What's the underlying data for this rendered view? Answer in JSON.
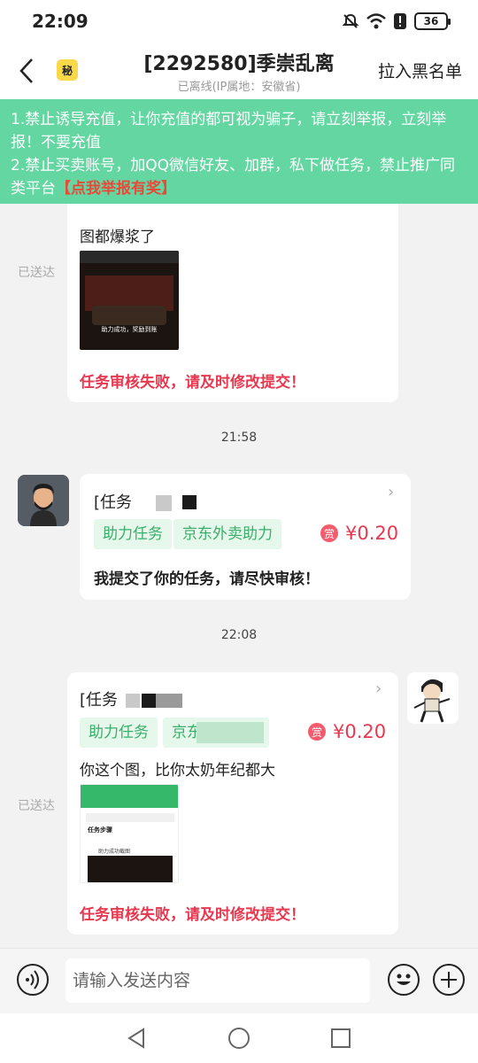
{
  "status_bar": {
    "time": "22:09",
    "battery": "36"
  },
  "header": {
    "secret_badge": "秘",
    "title": "[2292580]季崇乱离",
    "subtitle": "已离线(IP属地：安徽省)",
    "blacklist_label": "拉入黑名单"
  },
  "notice": {
    "line1": "1.禁止诱导充值，让你充值的都可视为骗子，请立刻举报，立刻举报！不要充值",
    "line2": "2.禁止买卖账号，加QQ微信好友、加群，私下做任务，禁止推广同类平台",
    "report_link": "【点我举报有奖】"
  },
  "messages": {
    "msg1": {
      "sent_status": "已送达",
      "text": "图都爆浆了",
      "thumb_caption": "助力成功，奖励到账",
      "fail_text": "任务审核失败，请及时修改提交！"
    },
    "time1": "21:58",
    "msg2": {
      "task_title": "[任务",
      "tag1": "助力任务",
      "tag2": "京东外卖助力",
      "reward_icon": "赏",
      "reward_amount": "¥0.20",
      "text": "我提交了你的任务，请尽快审核！"
    },
    "time2": "22:08",
    "msg3": {
      "sent_status": "已送达",
      "task_title": "[任务",
      "tag1": "助力任务",
      "tag2": "京东",
      "reward_icon": "赏",
      "reward_amount": "¥0.20",
      "text": "你这个图，比你太奶年纪都大",
      "thumb_title": "任务步骤",
      "thumb_step": "助力成功截图",
      "fail_text": "任务审核失败，请及时修改提交！"
    }
  },
  "input": {
    "placeholder": "请输入发送内容"
  },
  "colors": {
    "notice_bg": "#63d6a1",
    "tag_bg": "#e6f7ec",
    "tag_text": "#3aae69",
    "reward": "#e8384f"
  }
}
